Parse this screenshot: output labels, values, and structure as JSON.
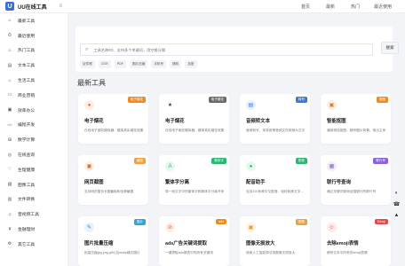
{
  "app": {
    "logo_mark": "U",
    "title": "UU在线工具",
    "collapse_icon": "≡"
  },
  "topnav": [
    "首页",
    "最新",
    "热门",
    "最近使用"
  ],
  "sidebar": [
    {
      "icon": "⌂",
      "label": "最新工具"
    },
    {
      "icon": "⏱",
      "label": "最近使用"
    },
    {
      "icon": "♨",
      "label": "热门工具"
    },
    {
      "icon": "▤",
      "label": "文本工具"
    },
    {
      "icon": "⌂",
      "label": "生活工具"
    },
    {
      "icon": "▭",
      "label": "商业营销"
    },
    {
      "icon": "▣",
      "label": "效率办公"
    },
    {
      "icon": "</>",
      "label": "编程开发"
    },
    {
      "icon": "⊞",
      "label": "数学计算"
    },
    {
      "icon": "◎",
      "label": "在线查询"
    },
    {
      "icon": "♡",
      "label": "生理健康"
    },
    {
      "icon": "▨",
      "label": "图像工具"
    },
    {
      "icon": "▥",
      "label": "文件转换"
    },
    {
      "icon": "♫",
      "label": "音视频工具"
    },
    {
      "icon": "¥",
      "label": "金融理财"
    },
    {
      "icon": "⚙",
      "label": "其它工具"
    }
  ],
  "search": {
    "placeholder": "工具名称/ID、支持多个关键词，用空格分隔",
    "button": "搜索",
    "tags": [
      "证件照",
      "OCR",
      "PDF",
      "图片压缩",
      "手机号",
      "随机",
      "加密"
    ]
  },
  "section_title": "最新工具",
  "cards": [
    {
      "name": "电子烟花",
      "desc": "在线电子烟花模拟器，模拟真实烟花效果",
      "badge": "电子烟花",
      "badge_color": "#f08a1c",
      "icon": "●",
      "icon_color": "#e0662d",
      "icon_bg": "#fdeee3"
    },
    {
      "name": "电子烟花",
      "desc": "在线电子烟花模拟器，模拟真实烟花效果",
      "badge": "电子烟花",
      "badge_color": "#6b6b6b",
      "icon": "★",
      "icon_color": "#3a3f58",
      "icon_bg": "#ffffff"
    },
    {
      "name": "音频转文本",
      "desc": "音频转写，将录音等音频文件转换为文字",
      "badge": "转写",
      "badge_color": "#3b7be0",
      "icon": "▤",
      "icon_color": "#3b7be0",
      "icon_bg": "#e8f0fd"
    },
    {
      "name": "智能抠图",
      "desc": "通用物品抠图，移除图片背景，抠出主体",
      "badge": "抠图",
      "badge_color": "#f08a1c",
      "icon": "▣",
      "icon_color": "#e07a2d",
      "icon_bg": "#fdeee3"
    },
    {
      "name": "网页截图",
      "desc": "支持网页整页长图截取和全屏截图",
      "badge": "截图",
      "badge_color": "#f0a03c",
      "icon": "▣",
      "icon_color": "#e0662d",
      "icon_bg": "#fdeee3"
    },
    {
      "name": "繁体字分离",
      "desc": "将一段文字中的繁体字和简体字分离开来",
      "badge": "繁体字",
      "badge_color": "#2bb673",
      "icon": "A",
      "icon_color": "#2bb673",
      "icon_bg": "#e6f7ee"
    },
    {
      "name": "配音助手",
      "desc": "支持100多种中文配音，轻松转换文字为语音",
      "badge": "配音",
      "badge_color": "#2bb673",
      "icon": "●",
      "icon_color": "#2bb673",
      "icon_bg": "#e6f7ee"
    },
    {
      "name": "联行号查询",
      "desc": "通过关键词查询全国银行的联行号",
      "badge": "联行号",
      "badge_color": "#8a63d2",
      "icon": "▦",
      "icon_color": "#8a63d2",
      "icon_bg": "#f1ebfb"
    },
    {
      "name": "图片批量压缩",
      "desc": "批量压缩jpg,png,gif以及webp格式图片",
      "badge": "图片",
      "badge_color": "#2aa7e0",
      "icon": "✎",
      "icon_color": "#2a7ee0",
      "icon_bg": "#e8f2fd"
    },
    {
      "name": "ads广告关键词提取",
      "desc": "一键提取ads报表中的所有关键词",
      "badge": "ads",
      "badge_color": "#f08a1c",
      "icon": "⊘",
      "icon_color": "#e0662d",
      "icon_bg": "#fdeee3"
    },
    {
      "name": "图像无损放大",
      "desc": "使用人工智能算法将图像无损放大",
      "badge": "图像",
      "badge_color": "#f0a03c",
      "icon": "▣",
      "icon_color": "#e09a2d",
      "icon_bg": "#fdf3e3"
    },
    {
      "name": "去除emoji表情",
      "desc": "移除文本中所有的emoji表情",
      "badge": "Emoji",
      "badge_color": "#e04a4a",
      "icon": "☺",
      "icon_color": "#e04a4a",
      "icon_bg": "#fdeaea"
    }
  ],
  "floatbar": [
    "◐",
    "☎",
    "▲"
  ]
}
